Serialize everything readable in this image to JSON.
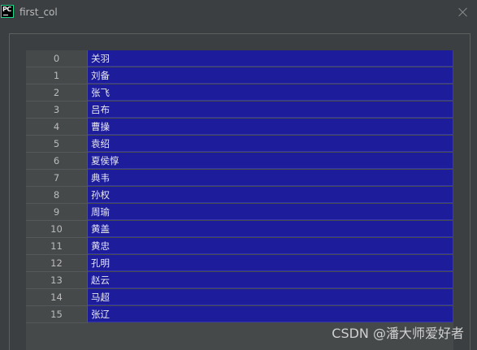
{
  "window": {
    "title": "first_col",
    "app_icon_text": "PC"
  },
  "table": {
    "rows": [
      {
        "index": "0",
        "value": "关羽"
      },
      {
        "index": "1",
        "value": "刘备"
      },
      {
        "index": "2",
        "value": "张飞"
      },
      {
        "index": "3",
        "value": "吕布"
      },
      {
        "index": "4",
        "value": "曹操"
      },
      {
        "index": "5",
        "value": "袁绍"
      },
      {
        "index": "6",
        "value": "夏侯惇"
      },
      {
        "index": "7",
        "value": "典韦"
      },
      {
        "index": "8",
        "value": "孙权"
      },
      {
        "index": "9",
        "value": "周瑜"
      },
      {
        "index": "10",
        "value": "黄盖"
      },
      {
        "index": "11",
        "value": "黄忠"
      },
      {
        "index": "12",
        "value": "孔明"
      },
      {
        "index": "13",
        "value": "赵云"
      },
      {
        "index": "14",
        "value": "马超"
      },
      {
        "index": "15",
        "value": "张辽"
      }
    ]
  },
  "watermark": "CSDN @潘大师爱好者",
  "colors": {
    "background": "#3c3f41",
    "value_cell": "#1d1d9c",
    "index_cell": "#45494a"
  }
}
